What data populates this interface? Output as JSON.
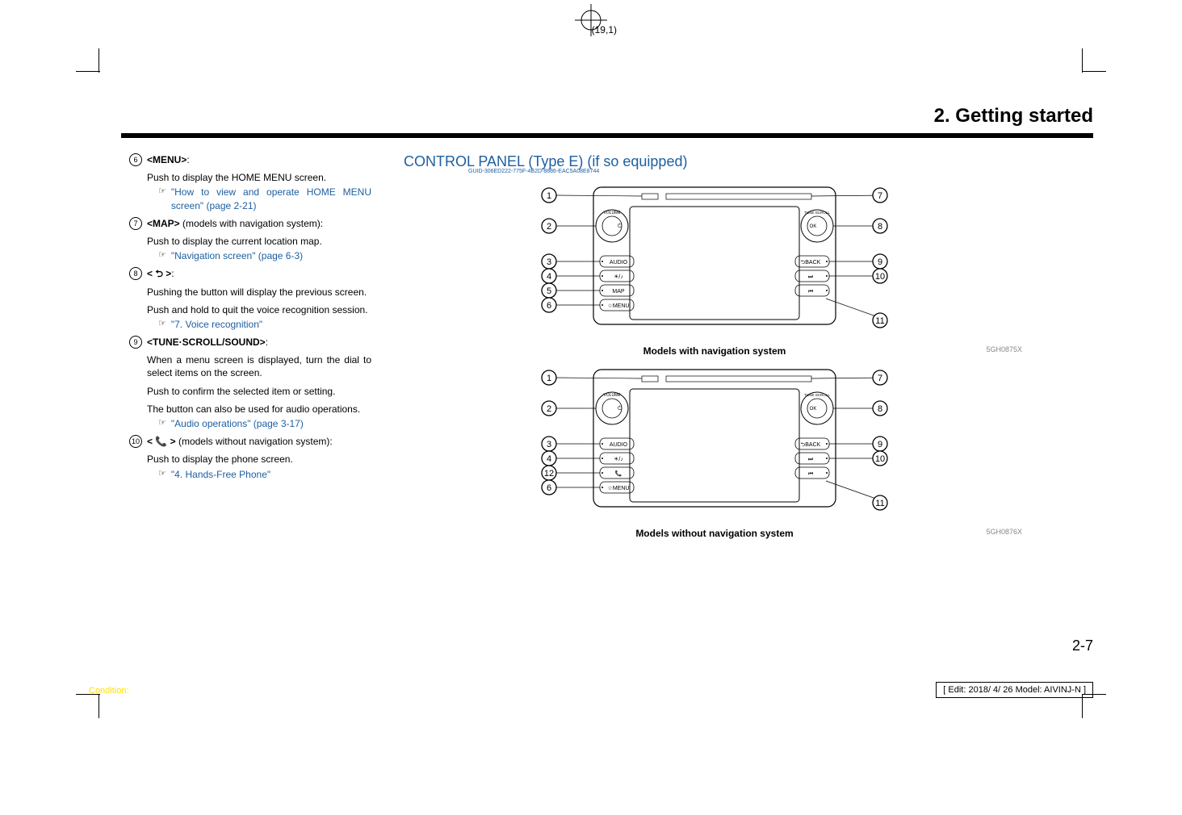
{
  "page_coord": "(19,1)",
  "header_title": "2. Getting started",
  "left": {
    "items": [
      {
        "num": "6",
        "title": "<MENU>",
        "after": ":",
        "paras": [
          "Push to display the HOME MENU screen."
        ],
        "xref": "\"How to view and operate HOME MENU screen\" (page 2-21)"
      },
      {
        "num": "7",
        "title": "<MAP>",
        "after": " (models with navigation system):",
        "paras": [
          "Push to display the current location map."
        ],
        "xref": "\"Navigation screen\" (page 6-3)"
      },
      {
        "num": "8",
        "title": "< ⮌ >",
        "after": ":",
        "paras": [
          "Pushing the button will display the previous screen.",
          "Push and hold to quit the voice recognition session."
        ],
        "xref": "\"7. Voice recognition\""
      },
      {
        "num": "9",
        "title": "<TUNE·SCROLL/SOUND>",
        "after": ":",
        "paras": [
          "When a menu screen is displayed, turn the dial to select items on the screen.",
          "Push to confirm the selected item or setting.",
          "The button can also be used for audio operations."
        ],
        "xref": "\"Audio operations\" (page 3-17)"
      },
      {
        "num": "10",
        "title": "< 📞 >",
        "after": " (models without navigation system):",
        "paras": [
          "Push to display the phone screen."
        ],
        "xref": "\"4. Hands-Free Phone\""
      }
    ]
  },
  "right": {
    "section_title": "CONTROL PANEL (Type E) (if so equipped)",
    "guid": "GUID-306ED222-775F-4B2D-8886-EAC5A08E8744",
    "fig1": {
      "caption": "Models with navigation system",
      "code": "5GH0875X",
      "callouts": [
        "1",
        "2",
        "3",
        "4",
        "5",
        "6",
        "7",
        "8",
        "9",
        "10",
        "11"
      ],
      "buttons": [
        "AUDIO",
        "☀/♪",
        "MAP",
        "☆MENU",
        "⮌BACK",
        "⏭",
        "⏮"
      ],
      "volume_label": "VOLUME",
      "tune_label": "TUNE·SCROLL",
      "ok_label": "OK"
    },
    "fig2": {
      "caption": "Models without navigation system",
      "code": "5GH0876X",
      "callouts": [
        "1",
        "2",
        "3",
        "4",
        "12",
        "6",
        "7",
        "8",
        "9",
        "10",
        "11"
      ],
      "buttons": [
        "AUDIO",
        "☀/♪",
        "📞",
        "☆MENU",
        "⮌BACK",
        "⏭",
        "⏮"
      ],
      "volume_label": "VOLUME",
      "tune_label": "TUNE·SCROLL",
      "ok_label": "OK"
    }
  },
  "page_number": "2-7",
  "condition_label": "Condition:",
  "edit_note": "[ Edit: 2018/ 4/ 26   Model: AIVINJ-N ]",
  "xref_icon": "☞"
}
